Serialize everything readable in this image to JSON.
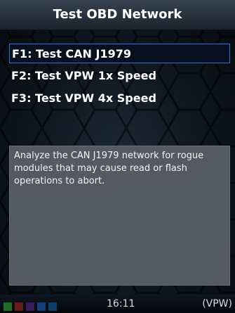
{
  "header": {
    "title": "Test OBD Network"
  },
  "menu": {
    "items": [
      {
        "label": "F1: Test CAN J1979",
        "selected": true
      },
      {
        "label": "F2: Test VPW 1x Speed",
        "selected": false
      },
      {
        "label": "F3: Test VPW 4x Speed",
        "selected": false
      }
    ]
  },
  "description": {
    "text": "Analyze the CAN J1979 network for rogue modules that may cause read or flash operations to abort."
  },
  "status": {
    "time": "16:11",
    "mode": "(VPW)",
    "indicator_colors": [
      "#1f6b2a",
      "#6b1a1a",
      "#3a1a5a",
      "#163c7a",
      "#0f3f66"
    ]
  },
  "colors": {
    "selection_border": "#3a6fd0",
    "description_background": "#555a60"
  }
}
